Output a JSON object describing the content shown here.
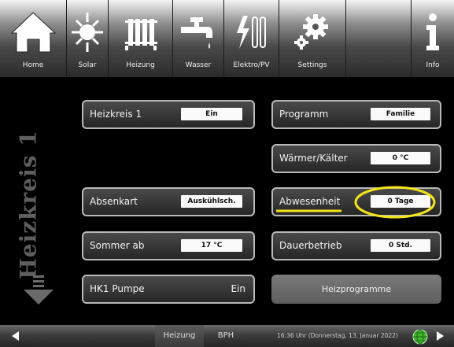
{
  "nav": {
    "items": [
      {
        "label": "Home",
        "icon": "home-icon"
      },
      {
        "label": "Solar",
        "icon": "sun-icon"
      },
      {
        "label": "Heizung",
        "icon": "radiator-icon"
      },
      {
        "label": "Wasser",
        "icon": "faucet-icon"
      },
      {
        "label": "Elektro/PV",
        "icon": "electric-pv-icon"
      },
      {
        "label": "Settings",
        "icon": "gears-icon"
      },
      {
        "label": "Info",
        "icon": "info-icon"
      }
    ]
  },
  "side": {
    "title": "Heizkreis 1"
  },
  "left_tiles": {
    "heizkreis": {
      "label": "Heizkreis 1",
      "value": "Ein"
    },
    "absenkart": {
      "label": "Absenkart",
      "value": "Auskühlsch."
    },
    "sommer": {
      "label": "Sommer ab",
      "value": "17 °C"
    },
    "pumpe": {
      "label": "HK1 Pumpe",
      "value": "Ein"
    }
  },
  "right_tiles": {
    "programm": {
      "label": "Programm",
      "value": "Familie"
    },
    "waermer": {
      "label": "Wärmer/Kälter",
      "value": "0 °C"
    },
    "abwesenheit": {
      "label": "Abwesenheit",
      "value": "0 Tage"
    },
    "dauerbetrieb": {
      "label": "Dauerbetrieb",
      "value": "0 Std."
    },
    "heizprogramme": {
      "label": "Heizprogramme"
    }
  },
  "bottom": {
    "seg1": "Heizung",
    "seg2": "BPH",
    "status": "16:36 Uhr (Donnerstag, 13. Januar 2022)"
  },
  "colors": {
    "highlight": "#f2e51a",
    "status_globe": "#3fb52a"
  }
}
